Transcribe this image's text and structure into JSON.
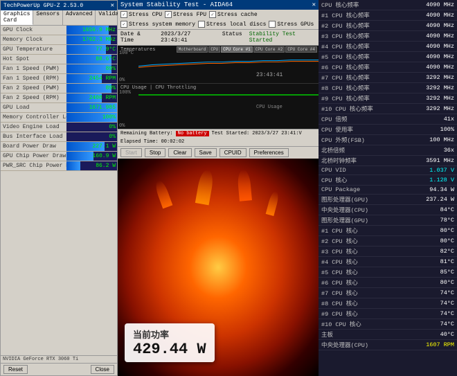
{
  "left": {
    "title": "TechPowerUp GPU-Z 2.53.0",
    "tabs": [
      "Graphics Card",
      "Sensors",
      "Advanced",
      "Validation"
    ],
    "rows": [
      {
        "label": "GPU Clock",
        "value": "1656.9 MHz",
        "bar": 83
      },
      {
        "label": "Memory Clock",
        "value": "1762.3 MHz",
        "bar": 88
      },
      {
        "label": "GPU Temperature",
        "value": "77.9°C",
        "bar": 78
      },
      {
        "label": "Hot Spot",
        "value": "88.6°C",
        "bar": 89
      },
      {
        "label": "Fan 1 Speed (PWM)",
        "value": "89%",
        "bar": 89
      },
      {
        "label": "Fan 1 Speed (RPM)",
        "value": "2454 RPM",
        "bar": 70
      },
      {
        "label": "Fan 2 Speed (PWM)",
        "value": "89%",
        "bar": 89
      },
      {
        "label": "Fan 2 Speed (RPM)",
        "value": "2408 RPM",
        "bar": 70
      },
      {
        "label": "GPU Load",
        "value": "1671.985",
        "bar": 100
      },
      {
        "label": "Memory Controller Load",
        "value": "100%",
        "bar": 100
      },
      {
        "label": "Video Engine Load",
        "value": "0%",
        "bar": 0
      },
      {
        "label": "Bus Interface Load",
        "value": "0%",
        "bar": 0
      },
      {
        "label": "Board Power Draw",
        "value": "227.1 W",
        "bar": 75
      },
      {
        "label": "GPU Chip Power Draw",
        "value": "160.9 W",
        "bar": 53
      },
      {
        "label": "PWR_SRC Chip Power Draw",
        "value": "86.2 W",
        "bar": 28
      }
    ],
    "nvidia_info": "NVIDIA GeForce RTX 3060 Ti",
    "reset_btn": "Reset",
    "close_btn": "Close"
  },
  "middle": {
    "title": "System Stability Test - AIDA64",
    "stress_items": [
      {
        "label": "Stress CPU",
        "checked": true
      },
      {
        "label": "Stress FPU",
        "checked": true
      },
      {
        "label": "Stress cache",
        "checked": true
      },
      {
        "label": "Stress system memory",
        "checked": true
      },
      {
        "label": "Stress local discs",
        "checked": false
      },
      {
        "label": "Stress GPUs",
        "checked": false
      }
    ],
    "datetime_label": "Date & Time",
    "datetime_value": "2023/3/27 23:43:41",
    "status_label": "Status",
    "status_value": "Stability Test Started",
    "graph1_label": "Temperatures",
    "graph1_tabs": [
      "Motherboard",
      "CPU",
      "CPU Core #1",
      "CPU Core #2",
      "CPU Core #4"
    ],
    "graph1_ymax": "100°C",
    "graph1_ymin": "0%",
    "graph2_label": "CPU Usage | CPU Throttling",
    "graph2_ymax": "100%",
    "graph2_ymin": "0%",
    "time_display": "23:43:41",
    "battery_label": "No battery",
    "test_started_label": "Test Started:",
    "test_started_value": "2023/3/27 23:41:V",
    "elapsed_label": "Elapsed Time:",
    "elapsed_value": "00:02:02",
    "buttons": [
      "Start",
      "Stop",
      "Clear",
      "Save",
      "CPUID",
      "Preferences"
    ]
  },
  "power": {
    "label": "当前功率",
    "value": "429.44 W"
  },
  "right": {
    "rows": [
      {
        "label": "CPU 核心频率",
        "value": "4090 MHz",
        "highlight": ""
      },
      {
        "label": "#1 CPU 核心频率",
        "value": "4090 MHz",
        "highlight": ""
      },
      {
        "label": "#2 CPU 核心频率",
        "value": "4090 MHz",
        "highlight": ""
      },
      {
        "label": "#3 CPU 核心频率",
        "value": "4090 MHz",
        "highlight": ""
      },
      {
        "label": "#4 CPU 核心频率",
        "value": "4090 MHz",
        "highlight": ""
      },
      {
        "label": "#5 CPU 核心频率",
        "value": "4090 MHz",
        "highlight": ""
      },
      {
        "label": "#6 CPU 核心频率",
        "value": "4090 MHz",
        "highlight": ""
      },
      {
        "label": "#7 CPU 核心频率",
        "value": "3292 MHz",
        "highlight": ""
      },
      {
        "label": "#8 CPU 核心频率",
        "value": "3292 MHz",
        "highlight": ""
      },
      {
        "label": "#9 CPU 核心频率",
        "value": "3292 MHz",
        "highlight": ""
      },
      {
        "label": "#10 CPU 核心频率",
        "value": "3292 MHz",
        "highlight": ""
      },
      {
        "label": "CPU 倍频",
        "value": "41x",
        "highlight": ""
      },
      {
        "label": "CPU 使用率",
        "value": "100%",
        "highlight": ""
      },
      {
        "label": "CPU 外频(FSB)",
        "value": "100 MHz",
        "highlight": ""
      },
      {
        "label": "北桥倍频",
        "value": "36x",
        "highlight": ""
      },
      {
        "label": "北桥时钟频率",
        "value": "3591 MHz",
        "highlight": ""
      },
      {
        "label": "CPU VID",
        "value": "1.037 V",
        "highlight": "cyan"
      },
      {
        "label": "CPU 核心",
        "value": "1.128 V",
        "highlight": "cyan"
      },
      {
        "label": "CPU Package",
        "value": "94.34 W",
        "highlight": ""
      },
      {
        "label": "图形处理器(GPU)",
        "value": "237.24 W",
        "highlight": ""
      },
      {
        "label": "中央处理器(CPU)",
        "value": "84°C",
        "highlight": ""
      },
      {
        "label": "图形处理器(GPU)",
        "value": "78°C",
        "highlight": ""
      },
      {
        "label": "#1 CPU 核心",
        "value": "80°C",
        "highlight": ""
      },
      {
        "label": "#2 CPU 核心",
        "value": "80°C",
        "highlight": ""
      },
      {
        "label": "#3 CPU 核心",
        "value": "82°C",
        "highlight": ""
      },
      {
        "label": "#4 CPU 核心",
        "value": "81°C",
        "highlight": ""
      },
      {
        "label": "#5 CPU 核心",
        "value": "85°C",
        "highlight": ""
      },
      {
        "label": "#6 CPU 核心",
        "value": "80°C",
        "highlight": ""
      },
      {
        "label": "#7 CPU 核心",
        "value": "74°C",
        "highlight": ""
      },
      {
        "label": "#8 CPU 核心",
        "value": "74°C",
        "highlight": ""
      },
      {
        "label": "#9 CPU 核心",
        "value": "74°C",
        "highlight": ""
      },
      {
        "label": "#10 CPU 核心",
        "value": "74°C",
        "highlight": ""
      },
      {
        "label": "主板",
        "value": "40°C",
        "highlight": ""
      },
      {
        "label": "中央处理器(CPU)",
        "value": "1607 RPM",
        "highlight": "yellow"
      }
    ]
  }
}
